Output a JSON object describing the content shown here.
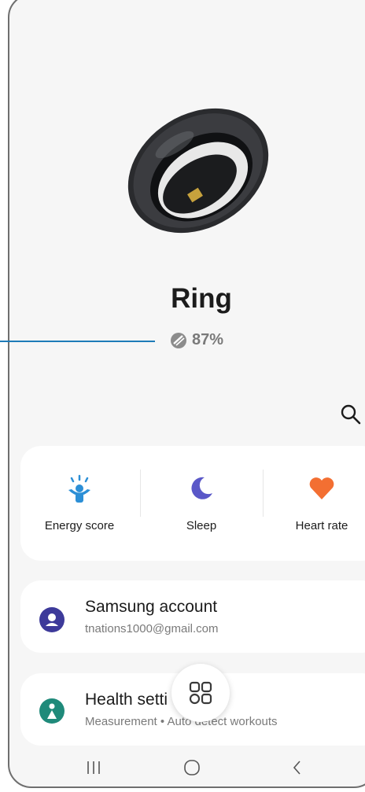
{
  "device": {
    "name": "Ring",
    "battery": "87%"
  },
  "metrics": [
    {
      "label": "Energy score",
      "icon": "energy-person-icon"
    },
    {
      "label": "Sleep",
      "icon": "moon-icon"
    },
    {
      "label": "Heart rate",
      "icon": "heart-icon"
    }
  ],
  "account": {
    "title": "Samsung account",
    "subtitle": "tnations1000@gmail.com"
  },
  "health": {
    "title": "Health setti",
    "subtitle": "Measurement • Auto detect workouts"
  },
  "colors": {
    "accent": "#1e7bb8",
    "energy": "#2c8fd6",
    "sleep": "#5a58c8",
    "heart": "#f36f32",
    "account": "#3d3a9a",
    "health": "#1f8a7a"
  }
}
